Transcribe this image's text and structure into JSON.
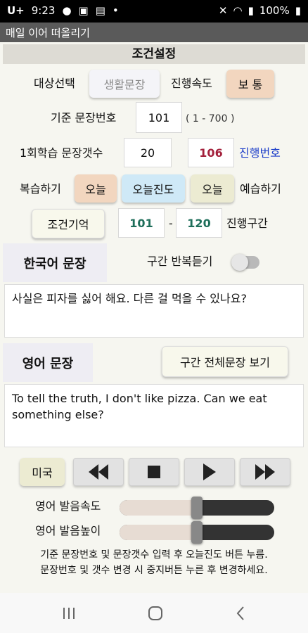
{
  "status": {
    "time": "9:23",
    "carrier": "U+",
    "battery": "100%"
  },
  "app": {
    "title": "매일 이어 떠올리기"
  },
  "header": {
    "title": "조건설정"
  },
  "target": {
    "label": "대상선택",
    "value": "생활문장"
  },
  "speed": {
    "label": "진행속도",
    "value": "보 통"
  },
  "base": {
    "label": "기준 문장번호",
    "value": "101",
    "range": "( 1 - 700 )"
  },
  "count": {
    "label": "1회학습 문장갯수",
    "value": "20",
    "progress_value": "106",
    "progress_label": "진행번호"
  },
  "review": {
    "label": "복습하기",
    "today_btn": "오늘",
    "progress_btn": "오늘진도",
    "today_btn2": "오늘",
    "preview_label": "예습하기"
  },
  "memory": {
    "button": "조건기억",
    "start": "101",
    "dash": "-",
    "end": "120",
    "range_label": "진행구간"
  },
  "korean": {
    "label": "한국어 문장",
    "repeat_label": "구간 반복듣기",
    "sentence": "사실은 피자를 싫어 해요. 다른 걸 먹을 수 있나요?"
  },
  "english": {
    "label": "영어 문장",
    "view_all": "구간 전체문장 보기",
    "sentence": "To tell the truth, I don't like pizza. Can we eat something else?"
  },
  "controls": {
    "accent": "미국"
  },
  "sliders": {
    "rate_label": "영어 발음속도",
    "rate_value": 0.5,
    "pitch_label": "영어 발음높이",
    "pitch_value": 0.5
  },
  "notes": {
    "line1": "기준 문장번호 및 문장갯수 입력 후 오늘진도 버튼 누름.",
    "line2": "문장번호 및 갯수 변경 시 중지버튼 누른 후 변경하세요."
  },
  "colors": {
    "accent_orange": "#f2d6bf",
    "accent_blue": "#cfe9f7",
    "accent_beige": "#ecebd2",
    "link_blue": "#1a3cc9",
    "progress_red": "#a3203b",
    "teal_text": "#1e6e5a"
  }
}
